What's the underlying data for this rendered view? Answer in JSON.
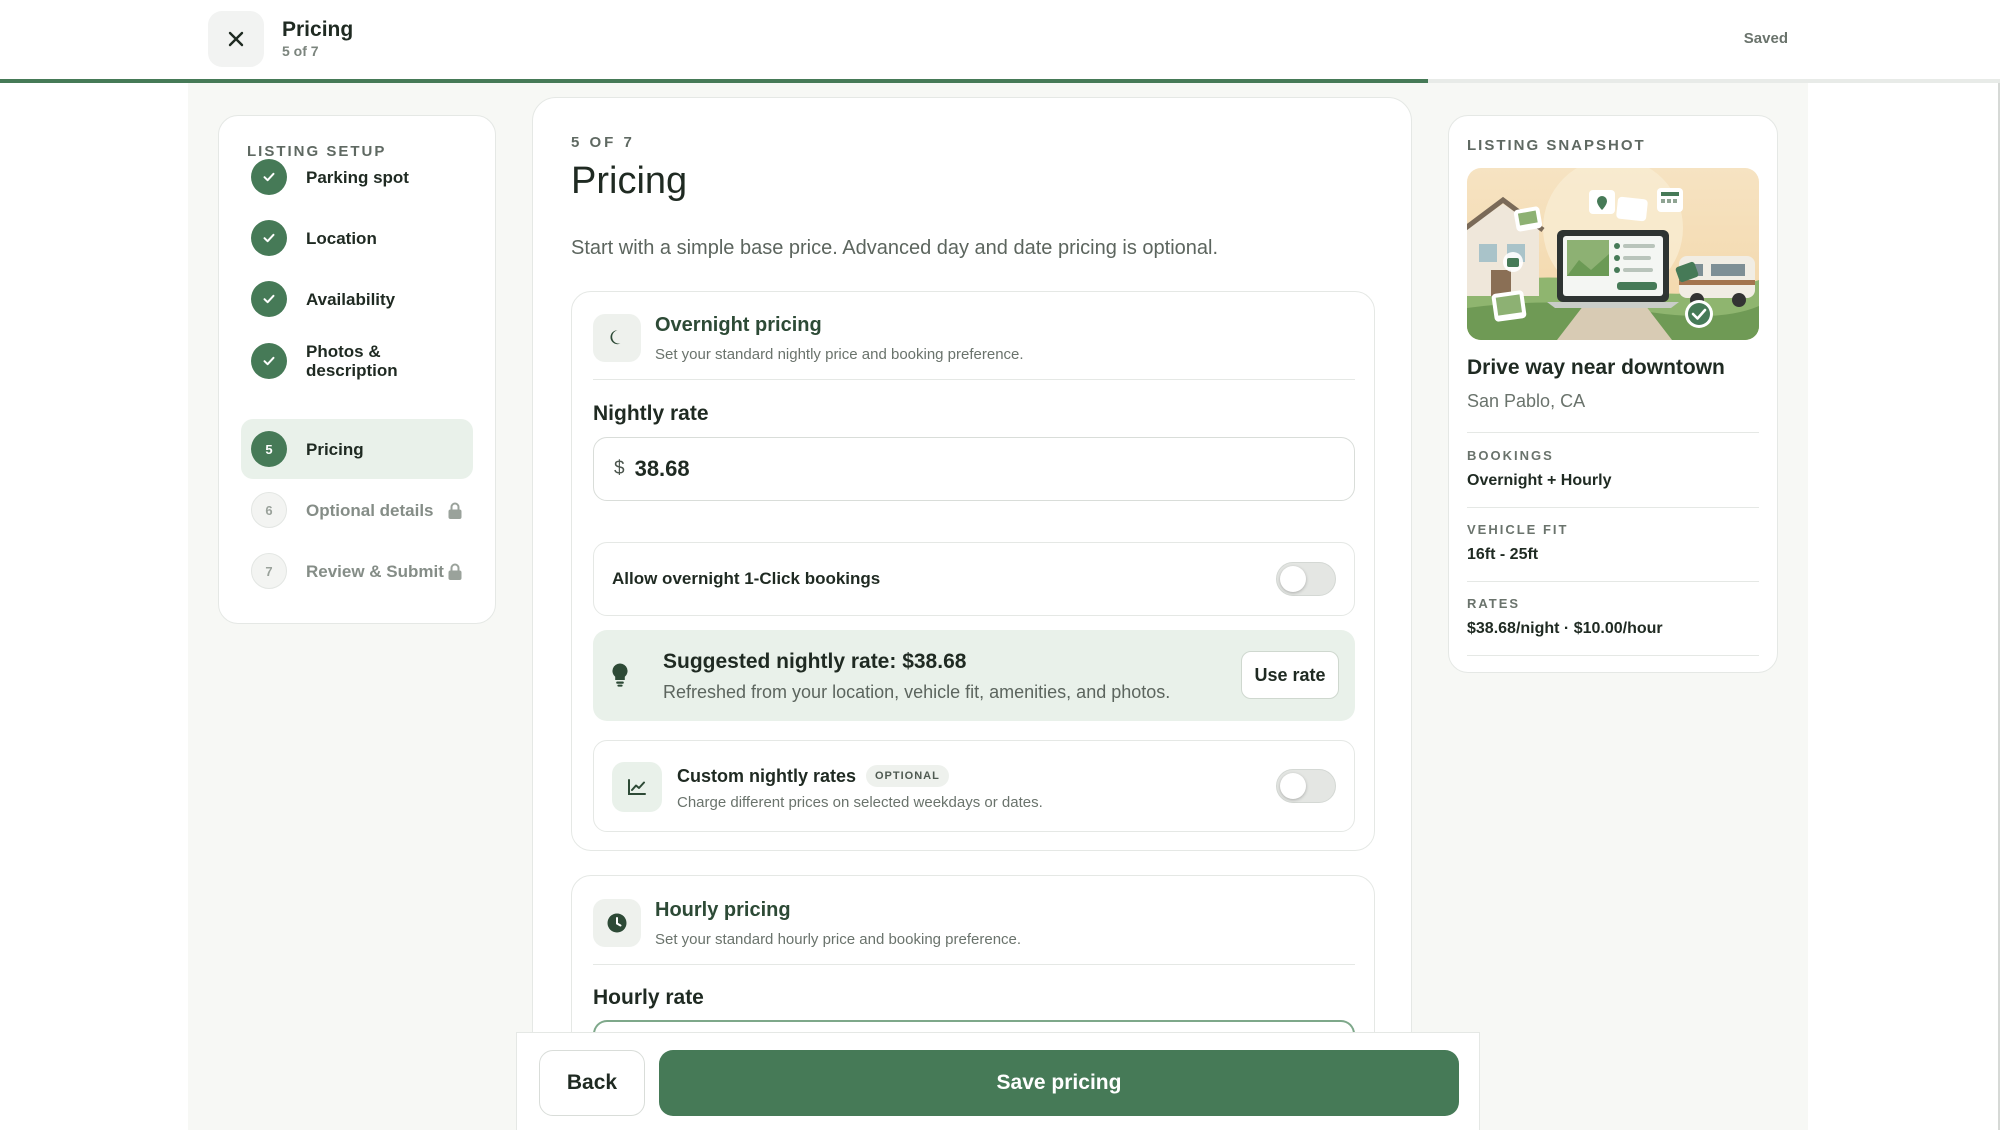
{
  "header": {
    "title": "Pricing",
    "step_counter": "5 of 7",
    "save_status": "Saved",
    "progress_fraction": 0.714
  },
  "sidebar": {
    "heading": "LISTING SETUP",
    "steps": [
      {
        "badge": "",
        "label": "Parking spot",
        "state": "done"
      },
      {
        "badge": "",
        "label": "Location",
        "state": "done"
      },
      {
        "badge": "",
        "label": "Availability",
        "state": "done"
      },
      {
        "badge": "",
        "label": "Photos & description",
        "state": "done"
      },
      {
        "badge": "5",
        "label": "Pricing",
        "state": "active"
      },
      {
        "badge": "6",
        "label": "Optional details",
        "state": "locked"
      },
      {
        "badge": "7",
        "label": "Review & Submit",
        "state": "locked"
      }
    ]
  },
  "main": {
    "eyebrow": "5 OF 7",
    "title": "Pricing",
    "intro": "Start with a simple base price. Advanced day and date pricing is optional.",
    "overnight": {
      "icon": "moon-icon",
      "title": "Overnight pricing",
      "subtitle": "Set your standard nightly price and booking preference.",
      "rate_label": "Nightly rate",
      "currency": "$",
      "rate_value": "38.68",
      "oneclick_label": "Allow overnight 1-Click bookings",
      "oneclick_enabled": false,
      "suggestion": {
        "icon": "lightbulb-icon",
        "title": "Suggested nightly rate: $38.68",
        "subtitle": "Refreshed from your location, vehicle fit, amenities, and photos.",
        "button": "Use rate"
      },
      "custom": {
        "icon": "trend-chart-icon",
        "title": "Custom nightly rates",
        "badge": "OPTIONAL",
        "subtitle": "Charge different prices on selected weekdays or dates.",
        "enabled": false
      }
    },
    "hourly": {
      "icon": "clock-icon",
      "title": "Hourly pricing",
      "subtitle": "Set your standard hourly price and booking preference.",
      "rate_label": "Hourly rate"
    }
  },
  "actions": {
    "back": "Back",
    "save": "Save pricing"
  },
  "snapshot": {
    "heading": "LISTING SNAPSHOT",
    "title": "Drive way near downtown",
    "location": "San Pablo, CA",
    "bookings_label": "BOOKINGS",
    "bookings_value": "Overnight + Hourly",
    "vehicle_fit_label": "VEHICLE FIT",
    "vehicle_fit_value": "16ft - 25ft",
    "rates_label": "RATES",
    "rates_value": "$38.68/night · $10.00/hour"
  },
  "colors": {
    "brand_green": "#467a57",
    "soft_green": "#e9f1ea",
    "page_bg": "#f7f8f5"
  }
}
